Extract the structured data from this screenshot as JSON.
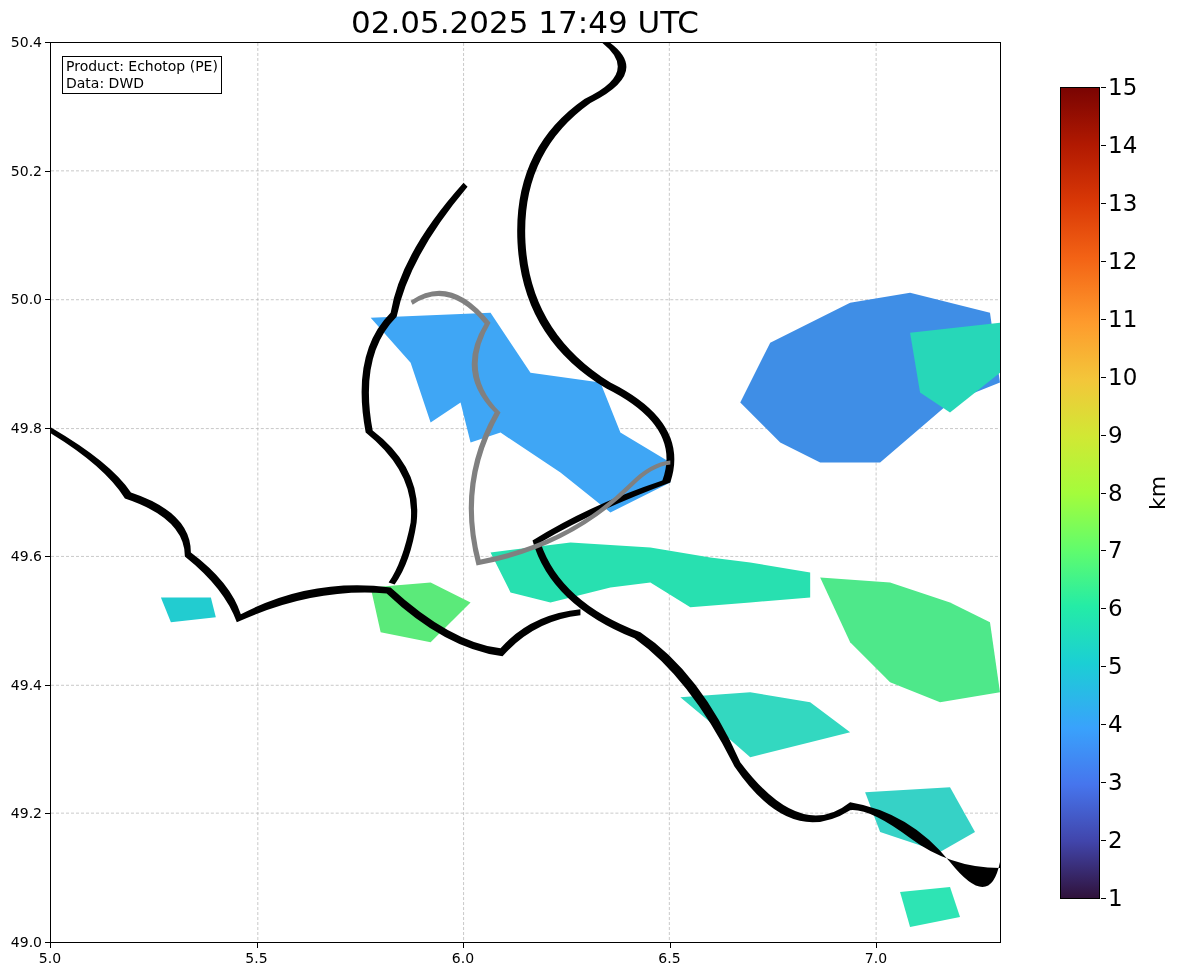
{
  "title": "02.05.2025 17:49 UTC",
  "info_box": [
    "Product: Echotop (PE)",
    "Data: DWD"
  ],
  "x_ticks": [
    "5.0",
    "5.5",
    "6.0",
    "6.5",
    "7.0"
  ],
  "y_ticks": [
    "50.4",
    "50.2",
    "50.0",
    "49.8",
    "49.6",
    "49.4",
    "49.2",
    "49.0"
  ],
  "colorbar": {
    "label": "km",
    "ticks": [
      "15",
      "14",
      "13",
      "12",
      "11",
      "10",
      "9",
      "8",
      "7",
      "6",
      "5",
      "4",
      "3",
      "2",
      "1"
    ]
  }
}
